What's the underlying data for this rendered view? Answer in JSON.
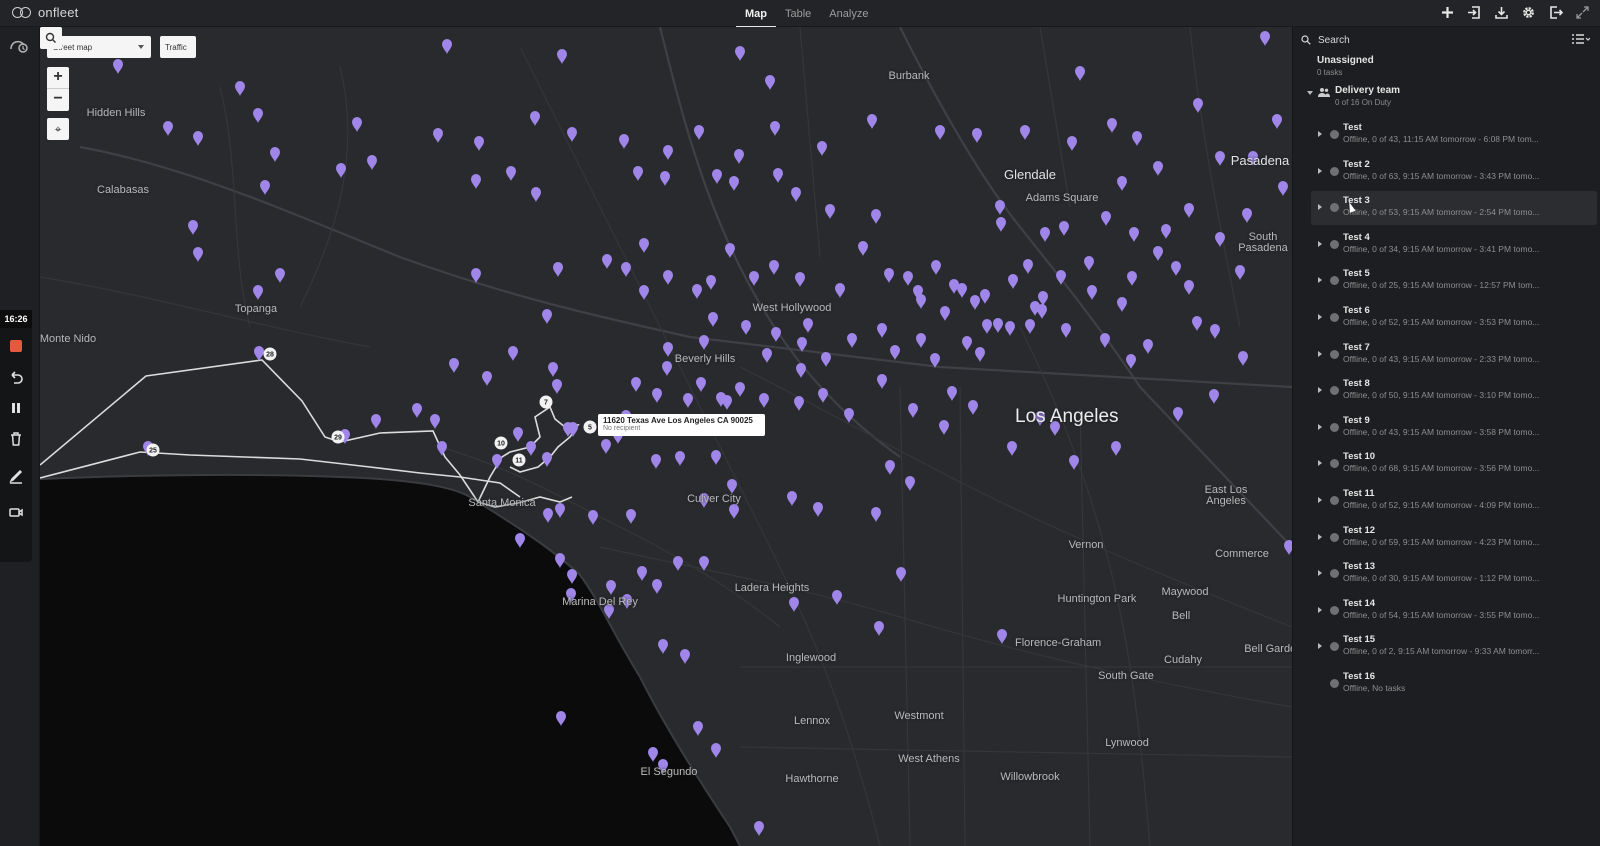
{
  "app": {
    "logo_text": "onfleet"
  },
  "nav": {
    "tabs": [
      {
        "label": "Map",
        "active": true
      },
      {
        "label": "Table",
        "active": false
      },
      {
        "label": "Analyze",
        "active": false
      }
    ]
  },
  "top_icons": [
    "add-icon",
    "import-icon",
    "download-icon",
    "settings-icon",
    "logout-icon",
    "expand-icon"
  ],
  "recorder": {
    "time": "16:26"
  },
  "map_controls": {
    "style_select": "Street map",
    "traffic_label": "Traffic"
  },
  "map_places": [
    {
      "name": "Burbank",
      "size": "small"
    },
    {
      "name": "Hidden Hills",
      "size": "small"
    },
    {
      "name": "Calabasas",
      "size": "small"
    },
    {
      "name": "Glendale",
      "size": "med"
    },
    {
      "name": "Adams Square",
      "size": "small"
    },
    {
      "name": "Pasadena",
      "size": "med"
    },
    {
      "name": "South Pasadena",
      "size": "small"
    },
    {
      "name": "Topanga",
      "size": "small"
    },
    {
      "name": "Monte Nido",
      "size": "small"
    },
    {
      "name": "West Hollywood",
      "size": "small"
    },
    {
      "name": "Beverly Hills",
      "size": "small"
    },
    {
      "name": "Los Angeles",
      "size": "big"
    },
    {
      "name": "Santa Monica",
      "size": "small"
    },
    {
      "name": "Culver City",
      "size": "small"
    },
    {
      "name": "East Los Angeles",
      "size": "small"
    },
    {
      "name": "Vernon",
      "size": "small"
    },
    {
      "name": "Commerce",
      "size": "small"
    },
    {
      "name": "Marina Del Rey",
      "size": "small"
    },
    {
      "name": "Ladera Heights",
      "size": "small"
    },
    {
      "name": "Huntington Park",
      "size": "small"
    },
    {
      "name": "Maywood",
      "size": "small"
    },
    {
      "name": "Bell",
      "size": "small"
    },
    {
      "name": "Florence-Graham",
      "size": "small"
    },
    {
      "name": "Cudahy",
      "size": "small"
    },
    {
      "name": "Bell Gardens",
      "size": "small"
    },
    {
      "name": "Inglewood",
      "size": "small"
    },
    {
      "name": "South Gate",
      "size": "small"
    },
    {
      "name": "Lennox",
      "size": "small"
    },
    {
      "name": "Westmont",
      "size": "small"
    },
    {
      "name": "Lynwood",
      "size": "small"
    },
    {
      "name": "West Athens",
      "size": "small"
    },
    {
      "name": "El Segundo",
      "size": "small"
    },
    {
      "name": "Hawthorne",
      "size": "small"
    },
    {
      "name": "Willowbrook",
      "size": "small"
    }
  ],
  "route_badges": [
    "28",
    "29",
    "25",
    "7",
    "5",
    "10",
    "11"
  ],
  "map_tooltip": {
    "address": "11620 Texas Ave Los Angeles CA 90025",
    "recipient": "No recipient"
  },
  "panel": {
    "search_placeholder": "Search",
    "unassigned": {
      "title": "Unassigned",
      "count": "0 tasks"
    },
    "team": {
      "name": "Delivery team",
      "duty": "0 of 16 On Duty"
    },
    "workers": [
      {
        "name": "Test",
        "status": "Offline, 0 of 43, 11:15 AM tomorrow - 6:08 PM tom..."
      },
      {
        "name": "Test 2",
        "status": "Offline, 0 of 63, 9:15 AM tomorrow - 3:43 PM tomo..."
      },
      {
        "name": "Test 3",
        "status": "Offline, 0 of 53, 9:15 AM tomorrow - 2:54 PM tomo..."
      },
      {
        "name": "Test 4",
        "status": "Offline, 0 of 34, 9:15 AM tomorrow - 3:41 PM tomo..."
      },
      {
        "name": "Test 5",
        "status": "Offline, 0 of 25, 9:15 AM tomorrow - 12:57 PM tom..."
      },
      {
        "name": "Test 6",
        "status": "Offline, 0 of 52, 9:15 AM tomorrow - 3:53 PM tomo..."
      },
      {
        "name": "Test 7",
        "status": "Offline, 0 of 43, 9:15 AM tomorrow - 2:33 PM tomo..."
      },
      {
        "name": "Test 8",
        "status": "Offline, 0 of 50, 9:15 AM tomorrow - 3:10 PM tomo..."
      },
      {
        "name": "Test 9",
        "status": "Offline, 0 of 43, 9:15 AM tomorrow - 3:58 PM tomo..."
      },
      {
        "name": "Test 10",
        "status": "Offline, 0 of 68, 9:15 AM tomorrow - 3:56 PM tomo..."
      },
      {
        "name": "Test 11",
        "status": "Offline, 0 of 52, 9:15 AM tomorrow - 4:09 PM tomo..."
      },
      {
        "name": "Test 12",
        "status": "Offline, 0 of 59, 9:15 AM tomorrow - 4:23 PM tomo..."
      },
      {
        "name": "Test 13",
        "status": "Offline, 0 of 30, 9:15 AM tomorrow - 1:12 PM tomo..."
      },
      {
        "name": "Test 14",
        "status": "Offline, 0 of 54, 9:15 AM tomorrow - 3:55 PM tomo..."
      },
      {
        "name": "Test 15",
        "status": "Offline, 0 of 2, 9:15 AM tomorrow - 9:33 AM tomorr..."
      },
      {
        "name": "Test 16",
        "status": "Offline, No tasks"
      }
    ]
  },
  "colors": {
    "pin": "#9f86e8",
    "route": "#d9d9d9",
    "water": "#0b0b0c"
  }
}
